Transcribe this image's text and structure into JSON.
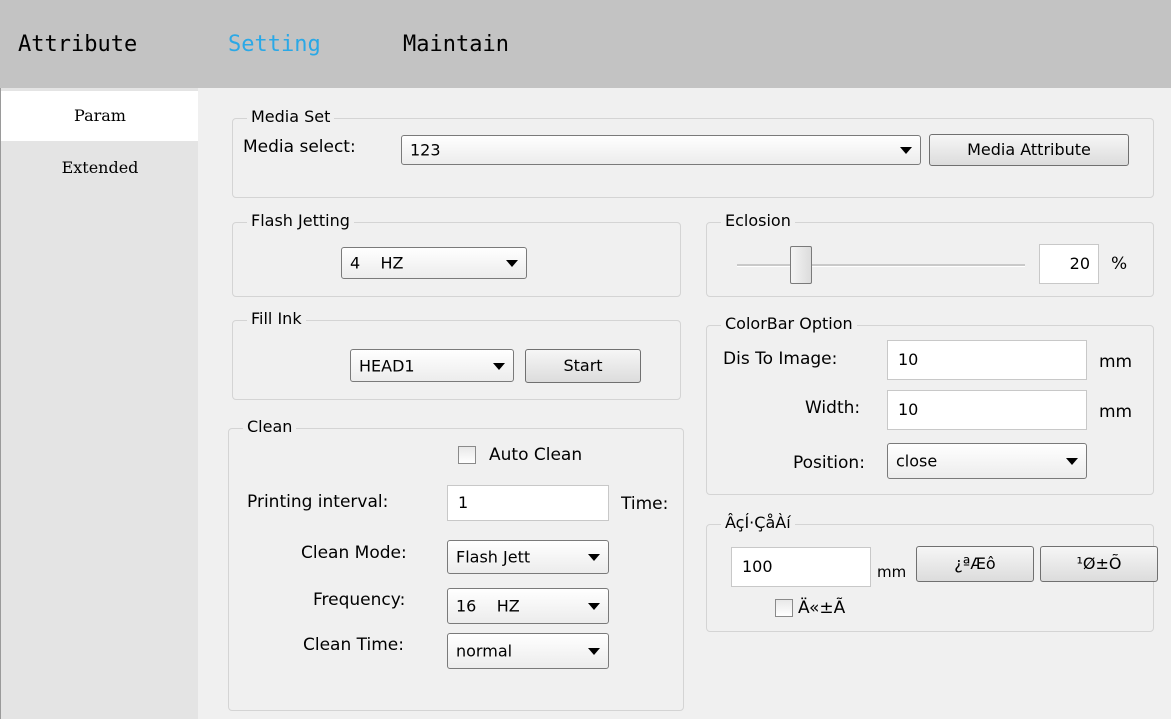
{
  "top_tabs": [
    {
      "label": "Attribute"
    },
    {
      "label": "Setting"
    },
    {
      "label": "Maintain"
    }
  ],
  "side_tabs": [
    {
      "label": "Param"
    },
    {
      "label": "Extended"
    }
  ],
  "media_set": {
    "title": "Media Set",
    "select_label": "Media select:",
    "select_value": "123",
    "attribute_button": "Media Attribute"
  },
  "flash_jetting": {
    "title": "Flash Jetting",
    "value": "4    HZ"
  },
  "fill_ink": {
    "title": "Fill Ink",
    "head_value": "HEAD1",
    "start_button": "Start"
  },
  "clean": {
    "title": "Clean",
    "auto_clean_label": "Auto Clean",
    "auto_clean_checked": false,
    "interval_label": "Printing interval:",
    "interval_value": "1",
    "interval_unit": "Time:",
    "mode_label": "Clean Mode:",
    "mode_value": "Flash Jett",
    "frequency_label": "Frequency:",
    "frequency_value": "16    HZ",
    "time_label": "Clean Time:",
    "time_value": "normal"
  },
  "eclosion": {
    "title": "Eclosion",
    "value": "20",
    "unit": "%",
    "slider_fraction": 0.2
  },
  "colorbar": {
    "title": "ColorBar Option",
    "dis_label": "Dis To Image:",
    "dis_value": "10",
    "dis_unit": "mm",
    "width_label": "Width:",
    "width_value": "10",
    "width_unit": "mm",
    "position_label": "Position:",
    "position_value": "close"
  },
  "garbled_group": {
    "title": "ÂçÍ·ÇåÀí",
    "value": "100",
    "unit": "mm",
    "button1": "¿ªÆô",
    "button2": "¹Ø±Õ",
    "check_label": "Ä«±Ã",
    "check_checked": false
  },
  "colors": {
    "active_tab": "#2aa8e6",
    "topbar_bg": "#c3c3c3",
    "panel_bg": "#f0f0f0"
  }
}
